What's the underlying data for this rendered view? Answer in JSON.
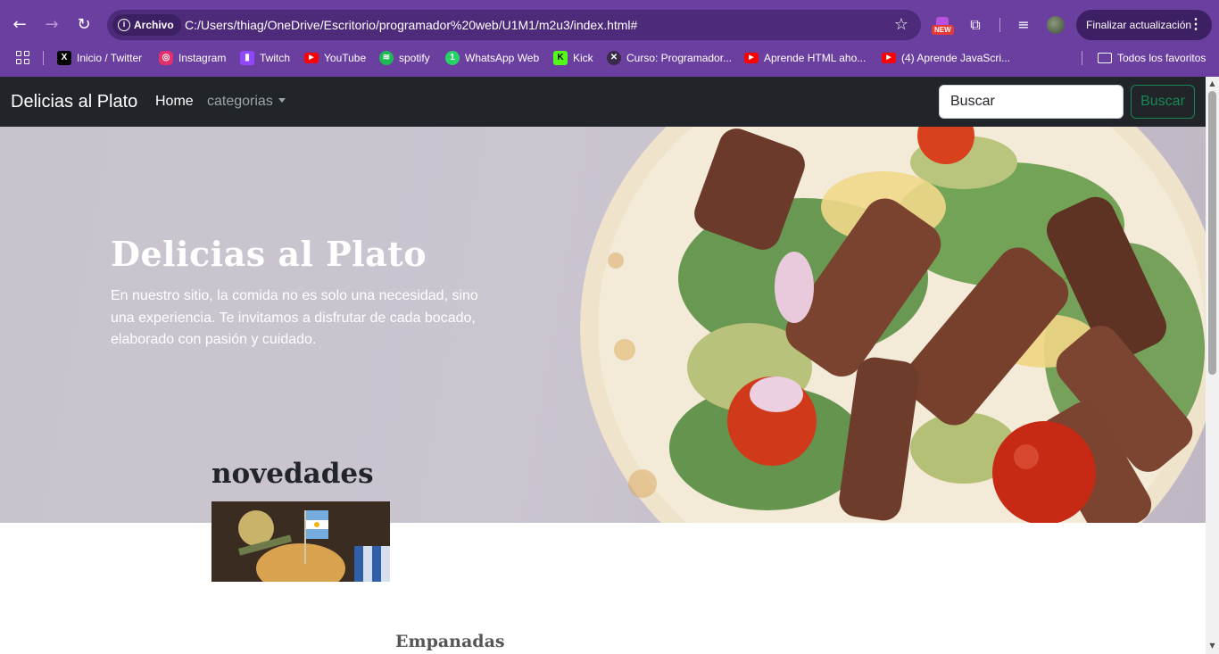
{
  "browser": {
    "site_chip": "Archivo",
    "url": "C:/Users/thiag/OneDrive/Escritorio/programador%20web/U1M1/m2u3/index.html#",
    "new_badge": "NEW",
    "update_button": "Finalizar actualización",
    "icons": [
      "back-arrow-icon",
      "forward-arrow-icon",
      "reload-icon",
      "info-icon",
      "star-icon",
      "extensions-icon",
      "media-icon",
      "profile-avatar",
      "more-icon"
    ]
  },
  "bookmarks": [
    {
      "label": "Inicio / Twitter",
      "icon": "x-icon",
      "color": "#000000"
    },
    {
      "label": "Instagram",
      "icon": "instagram-icon",
      "color": "#e1306c"
    },
    {
      "label": "Twitch",
      "icon": "twitch-icon",
      "color": "#9146ff"
    },
    {
      "label": "YouTube",
      "icon": "youtube-icon",
      "color": "#ff0000"
    },
    {
      "label": "spotify",
      "icon": "spotify-icon",
      "color": "#1db954"
    },
    {
      "label": "WhatsApp Web",
      "icon": "whatsapp-icon",
      "color": "#25d366"
    },
    {
      "label": "Kick",
      "icon": "kick-icon",
      "color": "#53fc18"
    },
    {
      "label": "Curso: Programador...",
      "icon": "course-icon",
      "color": "#3a2a4a"
    },
    {
      "label": "Aprende HTML aho...",
      "icon": "youtube-icon",
      "color": "#ff0000"
    },
    {
      "label": "(4) Aprende JavaScri...",
      "icon": "youtube-icon",
      "color": "#ff0000"
    }
  ],
  "all_bookmarks_label": "Todos los favoritos",
  "navbar": {
    "brand": "Delicias al Plato",
    "home": "Home",
    "categories": "categorias",
    "search_placeholder": "Buscar",
    "search_button": "Buscar"
  },
  "hero": {
    "title": "Delicias al Plato",
    "text": "En nuestro sitio, la comida no es solo una necesidad, sino una experiencia. Te invitamos a disfrutar de cada bocado, elaborado con pasión y cuidado."
  },
  "section": {
    "title": "novedades",
    "card_title": "Empanadas"
  },
  "colors": {
    "browser_frame": "#6b3fa0",
    "navbar_bg": "#212529",
    "search_button": "#198754"
  }
}
